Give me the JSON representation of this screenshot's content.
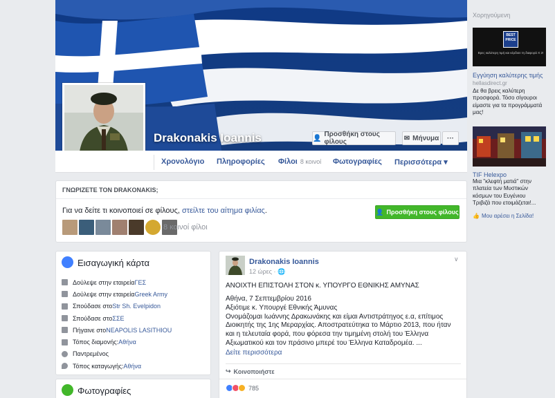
{
  "profile": {
    "name": "Drakonakis Ioannis",
    "add_friend_label": "Προσθήκη στους φίλους",
    "message_label": "Μήνυμα",
    "more_dots": "···"
  },
  "tabs": [
    {
      "label": "Χρονολόγιο"
    },
    {
      "label": "Πληροφορίες"
    },
    {
      "label": "Φίλοι",
      "count": "8 κοινοί"
    },
    {
      "label": "Φωτογραφίες"
    },
    {
      "label": "Περισσότερα ▾"
    }
  ],
  "know": {
    "heading": "ΓΝΩΡΙΖΕΤΕ ΤΟΝ DRAKONAKIS;",
    "text_prefix": "Για να δείτε τι κοινοποιεί σε φίλους, ",
    "text_link": "στείλτε του αίτημα φιλίας",
    "text_suffix": ".",
    "add_button": "Προσθήκη στους φίλους",
    "mutual": "8 κοινοί φίλοι"
  },
  "intro": {
    "title": "Εισαγωγική κάρτα",
    "rows": [
      {
        "prefix": "Δούλεψε στην εταιρεία ",
        "link": "ΓΕΣ"
      },
      {
        "prefix": "Δούλεψε στην εταιρεία ",
        "link": "Greek Army"
      },
      {
        "prefix": "Σπούδασε στο ",
        "link": "Str Sh. Evelpidon"
      },
      {
        "prefix": "Σπούδασε στο ",
        "link": "ΣΣΕ"
      },
      {
        "prefix": "Πήγαινε στο ",
        "link": "NEAPOLIS LASITHIOU"
      },
      {
        "prefix": "Τόπος διαμονής: ",
        "link": "Αθήνα"
      },
      {
        "prefix": "Παντρεμένος",
        "link": ""
      },
      {
        "prefix": "Τόπος καταγωγής: ",
        "link": "Αθήνα"
      }
    ]
  },
  "photos": {
    "title": "Φωτογραφίες"
  },
  "post": {
    "author": "Drakonakis Ioannis",
    "time": "12 ώρες · 🌐",
    "title": "ΑΝΟΙΧΤΗ ΕΠΙΣΤΟΛΗ ΣΤΟΝ κ. ΥΠΟΥΡΓΟ ΕΘΝΙΚΗΣ ΑΜΥΝΑΣ",
    "body": "Αθήνα, 7 Σεπτεμβρίου 2016\nΑξιότιμε κ. Υπουργέ Εθνικής Άμυνας\nΟνομάζομαι Ιωάννης Δρακωνάκης και είμαι Αντιστράτηγος ε.α, επίτιμος Διοικητής της 1ης Μεραρχίας. Αποστρατεύτηκα το Μάρτιο 2013, που ήταν και η τελευταία φορά, που φόρεσα την τιμημένη στολή του Έλληνα Αξιωματικού και τον πράσινο μπερέ του Έλληνα Καταδρομέα. ...",
    "see_more": "Δείτε περισσότερα",
    "share_label": "Κοινοποιήστε",
    "reaction_count": "785"
  },
  "sidebar": {
    "sponsored_label": "Χορηγούμενη",
    "ad1": {
      "badge": "BEST PRICE",
      "tagline": "Βρες καλύτερη τιμή και κέρδισε τη διαφορά Χ 2!",
      "title": "Εγγύηση καλύτερης τιμής",
      "url": "hellasdirect.gr",
      "text": "Δε θα βρεις καλύτερη προσφορά. Τόσο σίγουροι είμαστε για τα προγράμματά μας!"
    },
    "ad2": {
      "title": "TIF Helexpo",
      "text": "Μια \"κλεφτή ματιά\" στην πλατεία των Μυστικών κόσμων του Ευγένιου Τριβιζά που ετοιμάζεται!...",
      "like_label": "Μου αρέσει η Σελίδα!"
    }
  },
  "colors": {
    "fb_link": "#365899",
    "green_button": "#42b72a",
    "flag_blue": "#1f4f9c"
  }
}
